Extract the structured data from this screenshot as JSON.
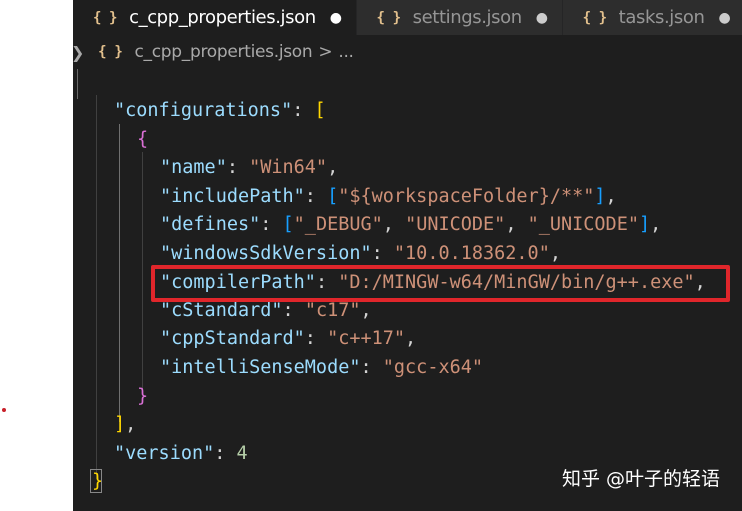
{
  "tabs": [
    {
      "label": "c_cpp_properties.json",
      "icon": "json-braces-icon",
      "dirty": "●",
      "active": true
    },
    {
      "label": "settings.json",
      "icon": "json-braces-icon",
      "dirty": "●",
      "active": false
    },
    {
      "label": "tasks.json",
      "icon": "json-braces-icon",
      "dirty": "●",
      "active": false
    }
  ],
  "icon_glyphs": {
    "braces": "{ }",
    "chevron_right": "❯"
  },
  "breadcrumb": {
    "file": "c_cpp_properties.json",
    "separator": ">",
    "rest": "..."
  },
  "code": {
    "line1_key": "\"configurations\"",
    "line1_colon": ": ",
    "line1_bracket": "[",
    "line2_brace": "{",
    "name_key": "\"name\"",
    "name_value": "\"Win64\"",
    "include_key": "\"includePath\"",
    "include_open": "[",
    "include_value": "\"${workspaceFolder}/**\"",
    "include_close": "]",
    "defines_key": "\"defines\"",
    "defines_open": "[",
    "defines_v1": "\"_DEBUG\"",
    "defines_v2": "\"UNICODE\"",
    "defines_v3": "\"_UNICODE\"",
    "defines_close": "]",
    "sdk_key": "\"windowsSdkVersion\"",
    "sdk_value": "\"10.0.18362.0\"",
    "compiler_key": "\"compilerPath\"",
    "compiler_value": "\"D:/MINGW-w64/MinGW/bin/g++.exe\"",
    "cstd_key": "\"cStandard\"",
    "cstd_value": "\"c17\"",
    "cppstd_key": "\"cppStandard\"",
    "cppstd_value": "\"c++17\"",
    "intelli_key": "\"intelliSenseMode\"",
    "intelli_value": "\"gcc-x64\"",
    "close_brace": "}",
    "close_bracket": "]",
    "version_key": "\"version\"",
    "version_value": "4",
    "root_close": "}",
    "colon": ": ",
    "comma": ",",
    "comma_space": ", "
  },
  "watermark": "知乎 @叶子的轻语",
  "colors": {
    "editor_bg": "#1e1e1e",
    "key": "#9cdcfe",
    "string": "#ce9178",
    "number": "#b5cea8",
    "highlight": "#e0262b"
  }
}
